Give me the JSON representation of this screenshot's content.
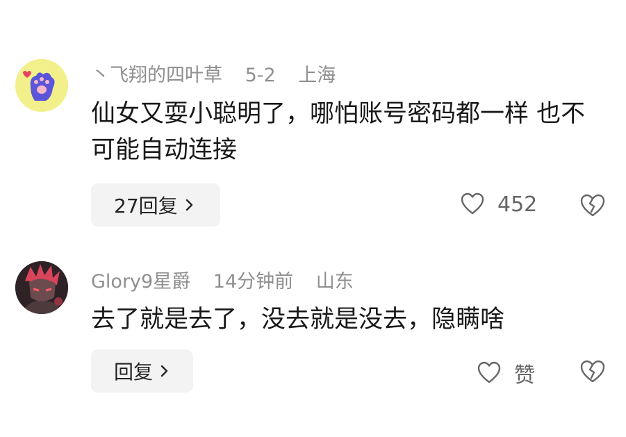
{
  "comments": [
    {
      "username": "丶飞翔的四叶草",
      "date": "5-2",
      "location": "上海",
      "text": "仙女又耍小聪明了，哪怕账号密码都一样 也不可能自动连接",
      "reply_label": "27回复",
      "like_count": "452",
      "avatar_icon": "paw-icon",
      "colors": {
        "avatar_bg": "#f2f08a",
        "paw": "#5a55d9"
      }
    },
    {
      "username": "Glory9星爵",
      "date": "14分钟前",
      "location": "山东",
      "text": "去了就是去了，没去就是没去，隐瞒啥",
      "reply_label": "回复",
      "like_count": "赞",
      "avatar_icon": "anime-character-avatar",
      "colors": {
        "avatar_bg": "#3a2a2e",
        "accent": "#d8445a"
      }
    }
  ],
  "icons": {
    "like": "heart-outline-icon",
    "dislike": "broken-heart-icon",
    "chevron": "chevron-right-icon"
  }
}
